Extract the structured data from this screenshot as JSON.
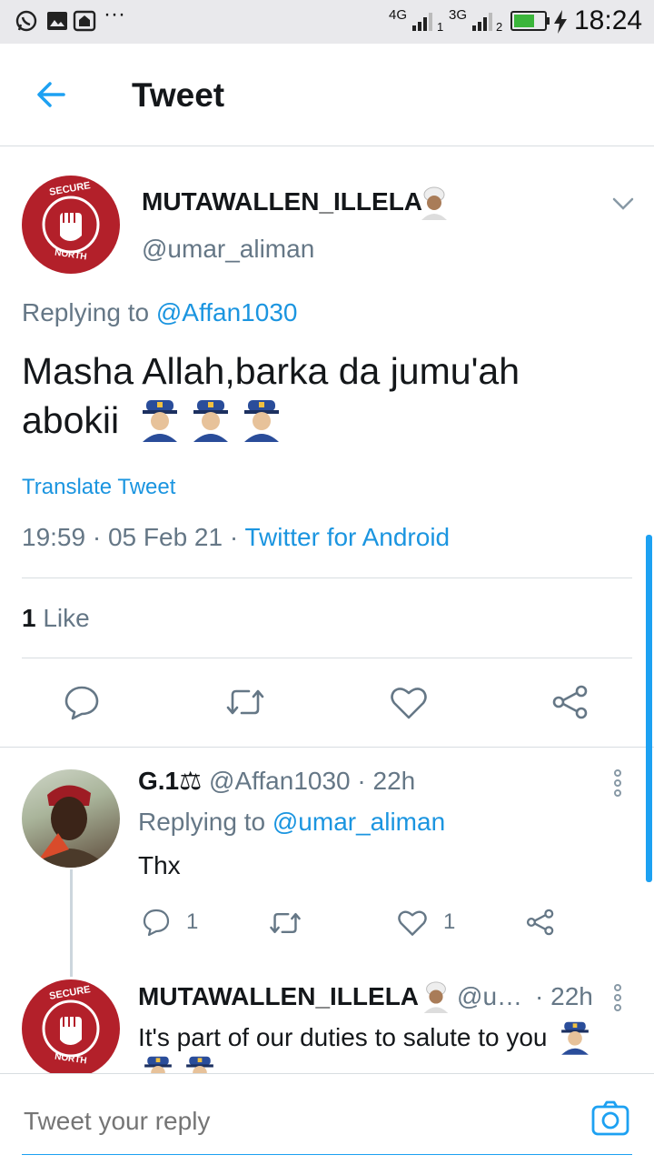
{
  "status_bar": {
    "net1": "4G",
    "sim1": "1",
    "net2": "3G",
    "sim2": "2",
    "time": "18:24",
    "icons": [
      "whatsapp-icon",
      "gallery-icon",
      "home-icon",
      "more-icon",
      "signal-icon",
      "battery-icon",
      "charging-icon"
    ]
  },
  "header": {
    "title": "Tweet"
  },
  "main_tweet": {
    "author_name": "MUTAWALLEN_ILLELA",
    "author_handle": "@umar_aliman",
    "avatar_text_top": "SECURE",
    "avatar_text_bottom": "NORTH",
    "replying_label": "Replying to ",
    "replying_handle": "@Affan1030",
    "text_line1": "Masha Allah,barka da jumu'ah",
    "text_line2": "abokii",
    "translate": "Translate Tweet",
    "time": "19:59",
    "date": "05 Feb 21",
    "source": "Twitter for Android",
    "sep": "·",
    "like_count": "1",
    "like_label": "Like"
  },
  "reply1": {
    "name": "G.1⚖",
    "handle": "@Affan1030",
    "time": "· 22h",
    "replying_label": "Replying to ",
    "replying_handle": "@umar_aliman",
    "text": "Thx",
    "reply_count": "1",
    "like_count": "1"
  },
  "reply2": {
    "name": "MUTAWALLEN_ILLELA",
    "handle": "@u…",
    "time": "· 22h",
    "text": "It's part of our duties to salute to you",
    "avatar_text_top": "SECURE",
    "avatar_text_bottom": "NORTH"
  },
  "compose": {
    "placeholder": "Tweet your reply"
  },
  "colors": {
    "accent": "#1da1f2",
    "link": "#1b95e0",
    "muted": "#657786",
    "avatar_red": "#b3202a"
  }
}
